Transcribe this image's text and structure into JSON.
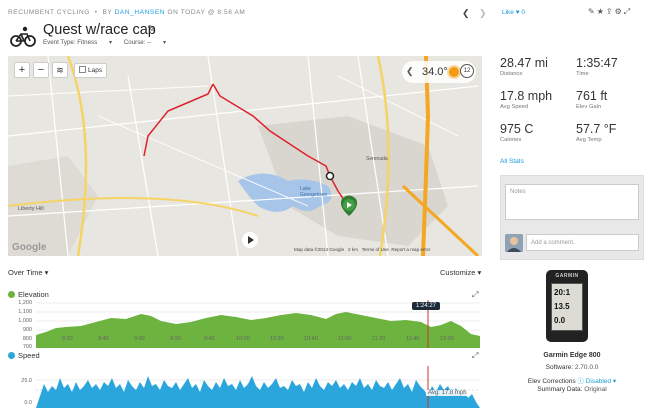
{
  "header": {
    "category": "RECUMBENT CYCLING",
    "by_label": "BY",
    "user": "DAN_HANSEN",
    "date_text": "ON TODAY @ 8:58 AM",
    "title": "Quest w/race cap",
    "event_type_label": "Event Type: Fitness",
    "course_label": "Course: --",
    "like_label": "Like",
    "like_count": "0",
    "icons": [
      "pencil-icon",
      "star-icon",
      "share-icon",
      "settings-icon",
      "expand-icon"
    ]
  },
  "map": {
    "zoom_in": "+",
    "zoom_out": "−",
    "laps_label": "Laps",
    "temperature": "34.0°",
    "clock_value": "12",
    "map_data_text": "Map data ©2014 Google",
    "scale_text": "2 km",
    "terms_text": "Terms of Use",
    "report_text": "Report a map error",
    "google_text": "Google",
    "place_labels": [
      "Serenada",
      "Lake Georgetown",
      "Liberty Hill"
    ],
    "colors": {
      "route": "#e0212b",
      "water": "#a7c5e8",
      "highway": "#f5a623"
    }
  },
  "charts": {
    "over_time_label": "Over Time",
    "customize_label": "Customize",
    "elevation": {
      "title": "Elevation",
      "color": "#6cb33f",
      "y_ticks": [
        "1,200",
        "1,100",
        "1,000",
        "900",
        "800",
        "700"
      ],
      "x_ticks": [
        "8:20",
        "8:40",
        "9:00",
        "9:20",
        "9:40",
        "10:00",
        "10:20",
        "10:40",
        "11:00",
        "11:20",
        "11:40",
        "12:00"
      ],
      "cursor_label": "1:24:27"
    },
    "speed": {
      "title": "Speed",
      "color": "#2aa6dd",
      "y_ticks": [
        "25.0",
        "0.0"
      ],
      "avg_label": "Avg: 17.8 mph"
    }
  },
  "stats": [
    {
      "value": "28.47 mi",
      "label": "Distance"
    },
    {
      "value": "1:35:47",
      "label": "Time"
    },
    {
      "value": "17.8 mph",
      "label": "Avg Speed"
    },
    {
      "value": "761 ft",
      "label": "Elev Gain"
    },
    {
      "value": "975 C",
      "label": "Calories"
    },
    {
      "value": "57.7 °F",
      "label": "Avg Temp"
    }
  ],
  "all_stats_label": "All Stats",
  "notes": {
    "label": "Notes",
    "comment_placeholder": "Add a comment."
  },
  "device": {
    "name": "Garmin Edge 800",
    "software_label": "Software:",
    "software_value": "2.70.0.0",
    "elev_label": "Elev Corrections",
    "elev_value": "Disabled",
    "summary_label": "Summary Data:",
    "summary_value": "Original",
    "screen_lines": [
      "20:1",
      "13.5",
      "0.0"
    ]
  }
}
